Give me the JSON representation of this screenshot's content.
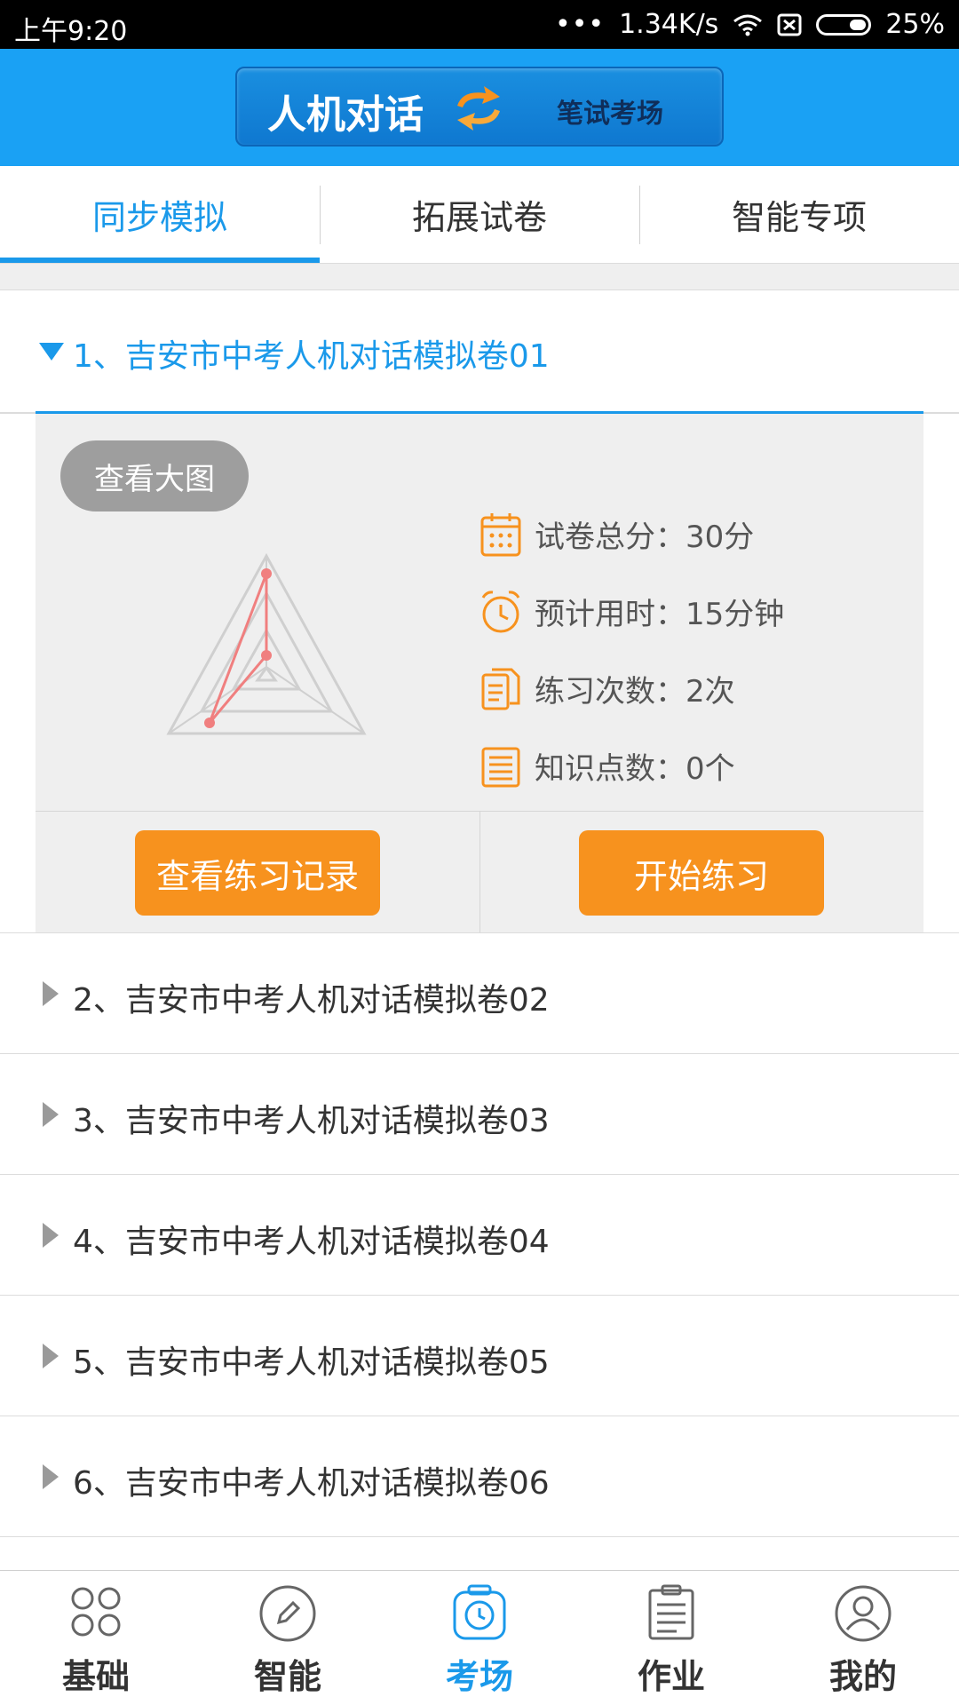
{
  "status_bar": {
    "time": "上午9:20",
    "dots": "•••",
    "speed": "1.34K/s",
    "battery": "25%"
  },
  "header": {
    "primary_mode": "人机对话",
    "secondary_mode": "笔试考场"
  },
  "tabs": [
    {
      "label": "同步模拟",
      "active": true
    },
    {
      "label": "拓展试卷",
      "active": false
    },
    {
      "label": "智能专项",
      "active": false
    }
  ],
  "expanded_item": {
    "title": "1、吉安市中考人机对话模拟卷01",
    "view_large_label": "查看大图",
    "stats": [
      {
        "label": "试卷总分：30分",
        "icon": "calendar-icon"
      },
      {
        "label": "预计用时：15分钟",
        "icon": "alarm-clock-icon"
      },
      {
        "label": "练习次数：2次",
        "icon": "documents-icon"
      },
      {
        "label": "知识点数：0个",
        "icon": "list-icon"
      }
    ],
    "view_records_label": "查看练习记录",
    "start_label": "开始练习"
  },
  "list_items": [
    "2、吉安市中考人机对话模拟卷02",
    "3、吉安市中考人机对话模拟卷03",
    "4、吉安市中考人机对话模拟卷04",
    "5、吉安市中考人机对话模拟卷05",
    "6、吉安市中考人机对话模拟卷06"
  ],
  "bottom_nav": [
    {
      "label": "基础",
      "icon": "grid-icon",
      "active": false
    },
    {
      "label": "智能",
      "icon": "pencil-icon",
      "active": false
    },
    {
      "label": "考场",
      "icon": "clock-icon",
      "active": true
    },
    {
      "label": "作业",
      "icon": "clipboard-icon",
      "active": false
    },
    {
      "label": "我的",
      "icon": "user-icon",
      "active": false
    }
  ],
  "colors": {
    "accent": "#1a99ea",
    "header": "#1aa1f4",
    "orange": "#f7921e",
    "panel": "#efefef"
  }
}
